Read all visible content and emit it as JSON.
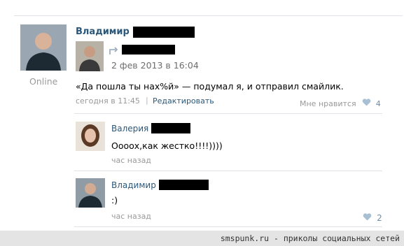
{
  "post": {
    "author_name": "Владимир",
    "online_label": "Online",
    "repost_date": "2 фев 2013 в 16:04",
    "text": "«Да пошла ты нах%й» — подумал я, и отправил смайлик.",
    "time": "сегодня в 11:45",
    "separator": "|",
    "edit_label": "Редактировать",
    "like_label": "Мне нравится",
    "like_count": "4"
  },
  "comments": [
    {
      "author_name": "Валерия",
      "text": "Оооох,как жестко!!!!))))",
      "time": "час назад"
    },
    {
      "author_name": "Владимир",
      "text": ":)",
      "time": "час назад",
      "like_count": "2"
    }
  ],
  "footer": {
    "text": "smspunk.ru - приколы социальных сетей"
  },
  "colors": {
    "link": "#2b587a",
    "grey": "#999999",
    "heart": "#a9bfd3",
    "footer_bg": "#e4e4e4"
  }
}
